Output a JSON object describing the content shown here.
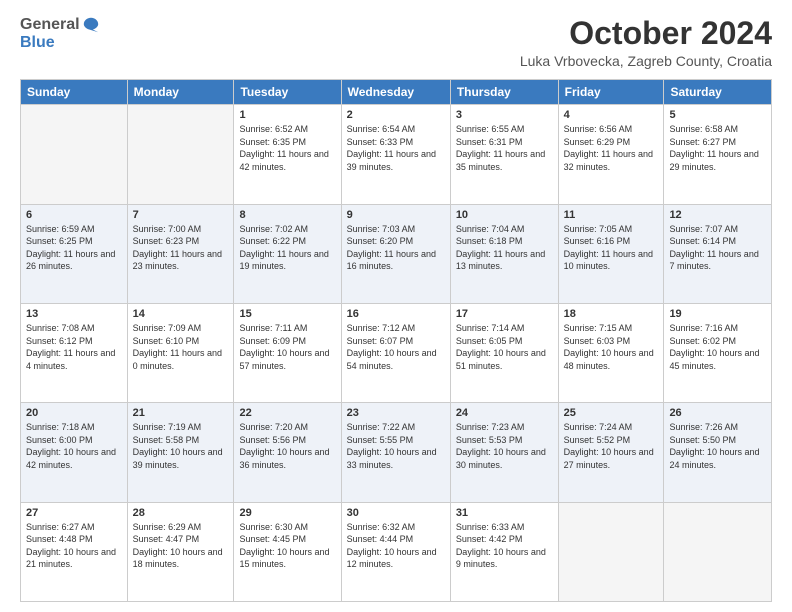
{
  "header": {
    "logo": {
      "general": "General",
      "blue": "Blue"
    },
    "title": "October 2024",
    "location": "Luka Vrbovecka, Zagreb County, Croatia"
  },
  "weekdays": [
    "Sunday",
    "Monday",
    "Tuesday",
    "Wednesday",
    "Thursday",
    "Friday",
    "Saturday"
  ],
  "weeks": [
    [
      {
        "day": "",
        "empty": true
      },
      {
        "day": "",
        "empty": true
      },
      {
        "day": "1",
        "sunrise": "Sunrise: 6:52 AM",
        "sunset": "Sunset: 6:35 PM",
        "daylight": "Daylight: 11 hours and 42 minutes."
      },
      {
        "day": "2",
        "sunrise": "Sunrise: 6:54 AM",
        "sunset": "Sunset: 6:33 PM",
        "daylight": "Daylight: 11 hours and 39 minutes."
      },
      {
        "day": "3",
        "sunrise": "Sunrise: 6:55 AM",
        "sunset": "Sunset: 6:31 PM",
        "daylight": "Daylight: 11 hours and 35 minutes."
      },
      {
        "day": "4",
        "sunrise": "Sunrise: 6:56 AM",
        "sunset": "Sunset: 6:29 PM",
        "daylight": "Daylight: 11 hours and 32 minutes."
      },
      {
        "day": "5",
        "sunrise": "Sunrise: 6:58 AM",
        "sunset": "Sunset: 6:27 PM",
        "daylight": "Daylight: 11 hours and 29 minutes."
      }
    ],
    [
      {
        "day": "6",
        "sunrise": "Sunrise: 6:59 AM",
        "sunset": "Sunset: 6:25 PM",
        "daylight": "Daylight: 11 hours and 26 minutes."
      },
      {
        "day": "7",
        "sunrise": "Sunrise: 7:00 AM",
        "sunset": "Sunset: 6:23 PM",
        "daylight": "Daylight: 11 hours and 23 minutes."
      },
      {
        "day": "8",
        "sunrise": "Sunrise: 7:02 AM",
        "sunset": "Sunset: 6:22 PM",
        "daylight": "Daylight: 11 hours and 19 minutes."
      },
      {
        "day": "9",
        "sunrise": "Sunrise: 7:03 AM",
        "sunset": "Sunset: 6:20 PM",
        "daylight": "Daylight: 11 hours and 16 minutes."
      },
      {
        "day": "10",
        "sunrise": "Sunrise: 7:04 AM",
        "sunset": "Sunset: 6:18 PM",
        "daylight": "Daylight: 11 hours and 13 minutes."
      },
      {
        "day": "11",
        "sunrise": "Sunrise: 7:05 AM",
        "sunset": "Sunset: 6:16 PM",
        "daylight": "Daylight: 11 hours and 10 minutes."
      },
      {
        "day": "12",
        "sunrise": "Sunrise: 7:07 AM",
        "sunset": "Sunset: 6:14 PM",
        "daylight": "Daylight: 11 hours and 7 minutes."
      }
    ],
    [
      {
        "day": "13",
        "sunrise": "Sunrise: 7:08 AM",
        "sunset": "Sunset: 6:12 PM",
        "daylight": "Daylight: 11 hours and 4 minutes."
      },
      {
        "day": "14",
        "sunrise": "Sunrise: 7:09 AM",
        "sunset": "Sunset: 6:10 PM",
        "daylight": "Daylight: 11 hours and 0 minutes."
      },
      {
        "day": "15",
        "sunrise": "Sunrise: 7:11 AM",
        "sunset": "Sunset: 6:09 PM",
        "daylight": "Daylight: 10 hours and 57 minutes."
      },
      {
        "day": "16",
        "sunrise": "Sunrise: 7:12 AM",
        "sunset": "Sunset: 6:07 PM",
        "daylight": "Daylight: 10 hours and 54 minutes."
      },
      {
        "day": "17",
        "sunrise": "Sunrise: 7:14 AM",
        "sunset": "Sunset: 6:05 PM",
        "daylight": "Daylight: 10 hours and 51 minutes."
      },
      {
        "day": "18",
        "sunrise": "Sunrise: 7:15 AM",
        "sunset": "Sunset: 6:03 PM",
        "daylight": "Daylight: 10 hours and 48 minutes."
      },
      {
        "day": "19",
        "sunrise": "Sunrise: 7:16 AM",
        "sunset": "Sunset: 6:02 PM",
        "daylight": "Daylight: 10 hours and 45 minutes."
      }
    ],
    [
      {
        "day": "20",
        "sunrise": "Sunrise: 7:18 AM",
        "sunset": "Sunset: 6:00 PM",
        "daylight": "Daylight: 10 hours and 42 minutes."
      },
      {
        "day": "21",
        "sunrise": "Sunrise: 7:19 AM",
        "sunset": "Sunset: 5:58 PM",
        "daylight": "Daylight: 10 hours and 39 minutes."
      },
      {
        "day": "22",
        "sunrise": "Sunrise: 7:20 AM",
        "sunset": "Sunset: 5:56 PM",
        "daylight": "Daylight: 10 hours and 36 minutes."
      },
      {
        "day": "23",
        "sunrise": "Sunrise: 7:22 AM",
        "sunset": "Sunset: 5:55 PM",
        "daylight": "Daylight: 10 hours and 33 minutes."
      },
      {
        "day": "24",
        "sunrise": "Sunrise: 7:23 AM",
        "sunset": "Sunset: 5:53 PM",
        "daylight": "Daylight: 10 hours and 30 minutes."
      },
      {
        "day": "25",
        "sunrise": "Sunrise: 7:24 AM",
        "sunset": "Sunset: 5:52 PM",
        "daylight": "Daylight: 10 hours and 27 minutes."
      },
      {
        "day": "26",
        "sunrise": "Sunrise: 7:26 AM",
        "sunset": "Sunset: 5:50 PM",
        "daylight": "Daylight: 10 hours and 24 minutes."
      }
    ],
    [
      {
        "day": "27",
        "sunrise": "Sunrise: 6:27 AM",
        "sunset": "Sunset: 4:48 PM",
        "daylight": "Daylight: 10 hours and 21 minutes."
      },
      {
        "day": "28",
        "sunrise": "Sunrise: 6:29 AM",
        "sunset": "Sunset: 4:47 PM",
        "daylight": "Daylight: 10 hours and 18 minutes."
      },
      {
        "day": "29",
        "sunrise": "Sunrise: 6:30 AM",
        "sunset": "Sunset: 4:45 PM",
        "daylight": "Daylight: 10 hours and 15 minutes."
      },
      {
        "day": "30",
        "sunrise": "Sunrise: 6:32 AM",
        "sunset": "Sunset: 4:44 PM",
        "daylight": "Daylight: 10 hours and 12 minutes."
      },
      {
        "day": "31",
        "sunrise": "Sunrise: 6:33 AM",
        "sunset": "Sunset: 4:42 PM",
        "daylight": "Daylight: 10 hours and 9 minutes."
      },
      {
        "day": "",
        "empty": true
      },
      {
        "day": "",
        "empty": true
      }
    ]
  ]
}
